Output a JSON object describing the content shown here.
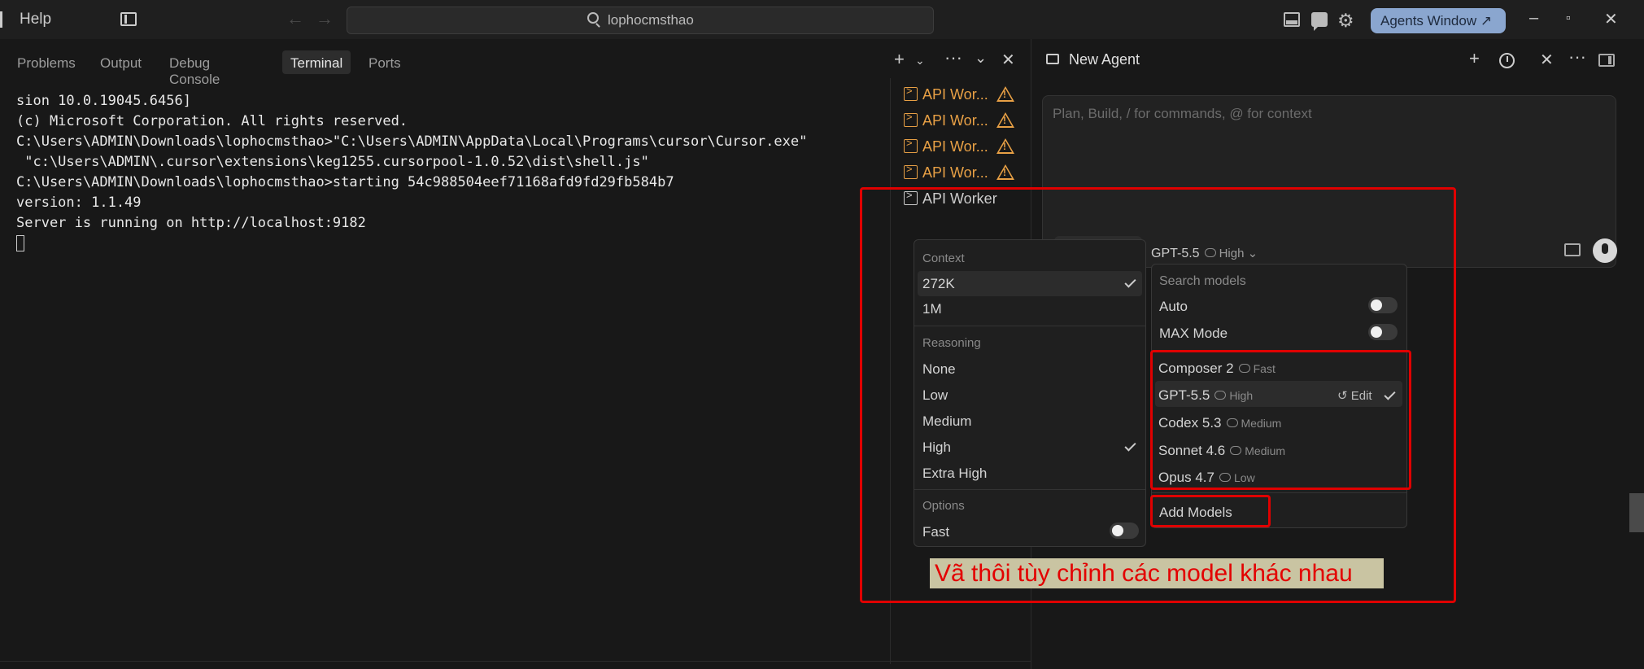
{
  "titlebar": {
    "help_label": "Help",
    "search_text": "lophocmsthao",
    "agents_window_label": "Agents Window ↗",
    "window_controls": [
      "–",
      "▫",
      "✕"
    ]
  },
  "panel": {
    "tabs": [
      "Problems",
      "Output",
      "Debug Console",
      "Terminal",
      "Ports"
    ],
    "active_tab": "Terminal"
  },
  "terminal": {
    "lines": [
      "sion 10.0.19045.6456]",
      "(c) Microsoft Corporation. All rights reserved.",
      "",
      "C:\\Users\\ADMIN\\Downloads\\lophocmsthao>\"C:\\Users\\ADMIN\\AppData\\Local\\Programs\\cursor\\Cursor.exe\"",
      " \"c:\\Users\\ADMIN\\.cursor\\extensions\\keg1255.cursorpool-1.0.52\\dist\\shell.js\"",
      "",
      "C:\\Users\\ADMIN\\Downloads\\lophocmsthao>starting 54c988504eef71168afd9fd29fb584b7",
      "version: 1.1.49",
      "Server is running on http://localhost:9182"
    ]
  },
  "terminal_list": {
    "items": [
      {
        "label": "API Wor...",
        "warning": true
      },
      {
        "label": "API Wor...",
        "warning": true
      },
      {
        "label": "API Wor...",
        "warning": true
      },
      {
        "label": "API Wor...",
        "warning": true
      },
      {
        "label": "API Worker",
        "warning": false
      }
    ]
  },
  "agent": {
    "title": "New Agent",
    "prompt_placeholder": "Plan, Build, / for commands, @ for context",
    "model_name": "GPT-5.5",
    "model_level": "High"
  },
  "context_popup": {
    "context_label": "Context",
    "context_options": [
      "272K",
      "1M"
    ],
    "context_selected": "272K",
    "reasoning_label": "Reasoning",
    "reasoning_options": [
      "None",
      "Low",
      "Medium",
      "High",
      "Extra High"
    ],
    "reasoning_selected": "High",
    "options_label": "Options",
    "fast_label": "Fast",
    "fast_on": false
  },
  "models_popup": {
    "search_placeholder": "Search models",
    "auto_label": "Auto",
    "auto_on": false,
    "max_label": "MAX Mode",
    "max_on": false,
    "models": [
      {
        "name": "Composer 2",
        "level": "Fast"
      },
      {
        "name": "GPT-5.5",
        "level": "High"
      },
      {
        "name": "Codex 5.3",
        "level": "Medium"
      },
      {
        "name": "Sonnet 4.6",
        "level": "Medium"
      },
      {
        "name": "Opus 4.7",
        "level": "Low"
      }
    ],
    "selected_model": "GPT-5.5",
    "edit_label": "Edit",
    "add_models_label": "Add Models"
  },
  "annotation": {
    "caption": "Vã thôi tùy chỉnh các model khác nhau",
    "color": "#e00000"
  }
}
